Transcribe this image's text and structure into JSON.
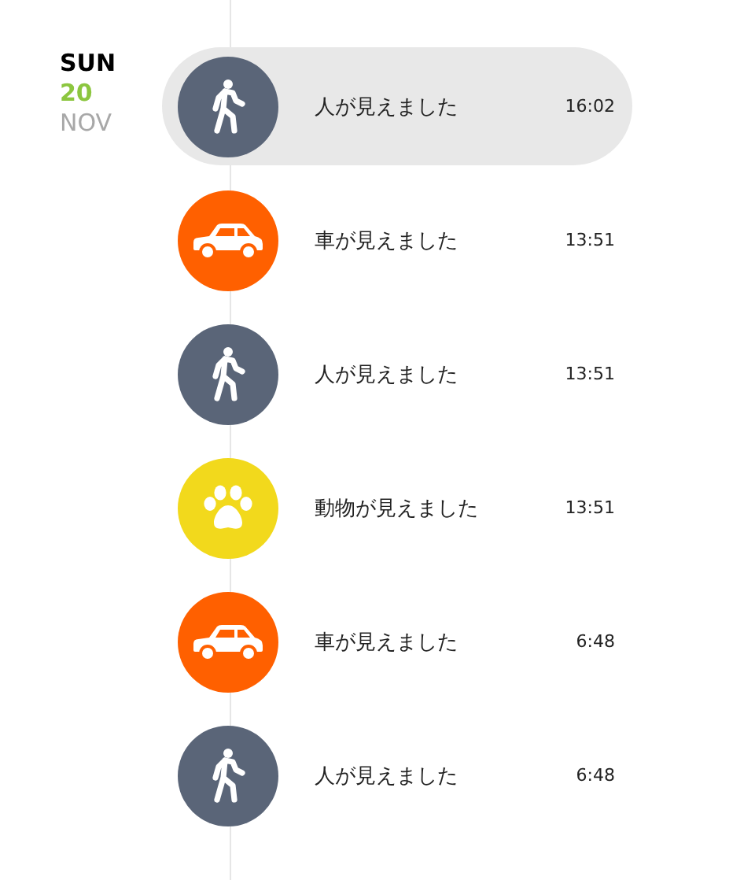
{
  "date": {
    "weekday": "SUN",
    "day": "20",
    "month": "NOV"
  },
  "events": [
    {
      "kind": "person",
      "color": "#5a6578",
      "label": "人が見えました",
      "time": "16:02",
      "selected": true
    },
    {
      "kind": "car",
      "color": "#ff6000",
      "label": "車が見えました",
      "time": "13:51",
      "selected": false
    },
    {
      "kind": "person",
      "color": "#5a6578",
      "label": "人が見えました",
      "time": "13:51",
      "selected": false
    },
    {
      "kind": "animal",
      "color": "#f2d91c",
      "label": "動物が見えました",
      "time": "13:51",
      "selected": false
    },
    {
      "kind": "car",
      "color": "#ff6000",
      "label": "車が見えました",
      "time": "6:48",
      "selected": false
    },
    {
      "kind": "person",
      "color": "#5a6578",
      "label": "人が見えました",
      "time": "6:48",
      "selected": false
    }
  ]
}
